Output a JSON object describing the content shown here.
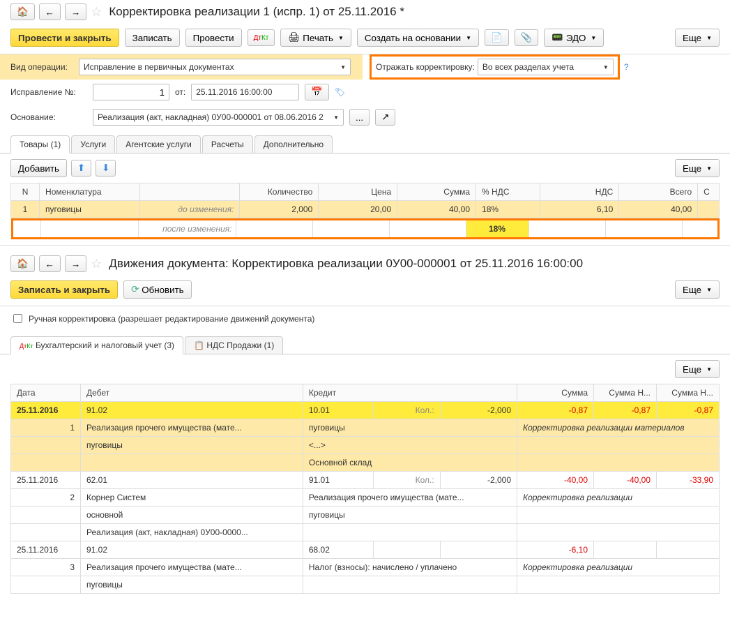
{
  "section1": {
    "title": "Корректировка реализации 1 (испр. 1) от 25.11.2016 *",
    "toolbar": {
      "post_close": "Провести и закрыть",
      "save": "Записать",
      "post": "Провести",
      "print": "Печать",
      "create_based": "Создать на основании",
      "edo": "ЭДО",
      "more": "Еще"
    },
    "operation_type": {
      "label": "Вид операции:",
      "value": "Исправление в первичных документах"
    },
    "reflect": {
      "label": "Отражать корректировку:",
      "value": "Во всех разделах учета"
    },
    "correction_no": {
      "label": "Исправление №:",
      "value": "1",
      "from": "от:",
      "date": "25.11.2016 16:00:00"
    },
    "basis": {
      "label": "Основание:",
      "value": "Реализация (акт, накладная) 0У00-000001 от 08.06.2016 2"
    },
    "tabs": [
      "Товары (1)",
      "Услуги",
      "Агентские услуги",
      "Расчеты",
      "Дополнительно"
    ],
    "add_btn": "Добавить",
    "more2": "Еще",
    "goods_table": {
      "headers": [
        "N",
        "Номенклатура",
        "",
        "Количество",
        "Цена",
        "Сумма",
        "% НДС",
        "НДС",
        "Всего",
        "С"
      ],
      "before_label": "до изменения:",
      "after_label": "после изменения:",
      "row": {
        "n": "1",
        "name": "пуговицы",
        "qty": "2,000",
        "price": "20,00",
        "sum": "40,00",
        "vat_pct": "18%",
        "vat": "6,10",
        "total": "40,00"
      },
      "after": {
        "vat_pct": "18%"
      }
    }
  },
  "section2": {
    "title": "Движения документа: Корректировка реализации 0У00-000001 от 25.11.2016 16:00:00",
    "toolbar": {
      "save_close": "Записать и закрыть",
      "refresh": "Обновить",
      "more": "Еще"
    },
    "manual_edit": "Ручная корректировка (разрешает редактирование движений документа)",
    "tabs": [
      "Бухгалтерский и налоговый учет (3)",
      "НДС Продажи (1)"
    ],
    "more2": "Еще",
    "mv_headers": [
      "Дата",
      "Дебет",
      "",
      "",
      "Кредит",
      "",
      "",
      "Сумма",
      "Сумма Н...",
      "Сумма Н..."
    ],
    "rows": [
      {
        "date": "25.11.2016",
        "n": "1",
        "debit_acct": "91.02",
        "credit_acct": "10.01",
        "qty_label": "Кол.:",
        "qty": "-2,000",
        "sum": "-0,87",
        "sum_n1": "-0,87",
        "sum_n2": "-0,87",
        "debit_lines": [
          "Реализация прочего имущества (мате...",
          "пуговицы"
        ],
        "credit_lines": [
          "пуговицы",
          "<...>",
          "Основной склад"
        ],
        "comment": "Корректировка реализации материалов",
        "highlight": true
      },
      {
        "date": "25.11.2016",
        "n": "2",
        "debit_acct": "62.01",
        "credit_acct": "91.01",
        "qty_label": "Кол.:",
        "qty": "-2,000",
        "sum": "-40,00",
        "sum_n1": "-40,00",
        "sum_n2": "-33,90",
        "debit_lines": [
          "Корнер Систем",
          "основной",
          "Реализация (акт, накладная) 0У00-0000..."
        ],
        "credit_lines": [
          "Реализация прочего имущества (мате...",
          "пуговицы"
        ],
        "comment": "Корректировка реализации"
      },
      {
        "date": "25.11.2016",
        "n": "3",
        "debit_acct": "91.02",
        "credit_acct": "68.02",
        "sum": "-6,10",
        "debit_lines": [
          "Реализация прочего имущества (мате...",
          "пуговицы"
        ],
        "credit_lines": [
          "Налог (взносы): начислено / уплачено"
        ],
        "comment": "Корректировка реализации"
      }
    ]
  }
}
